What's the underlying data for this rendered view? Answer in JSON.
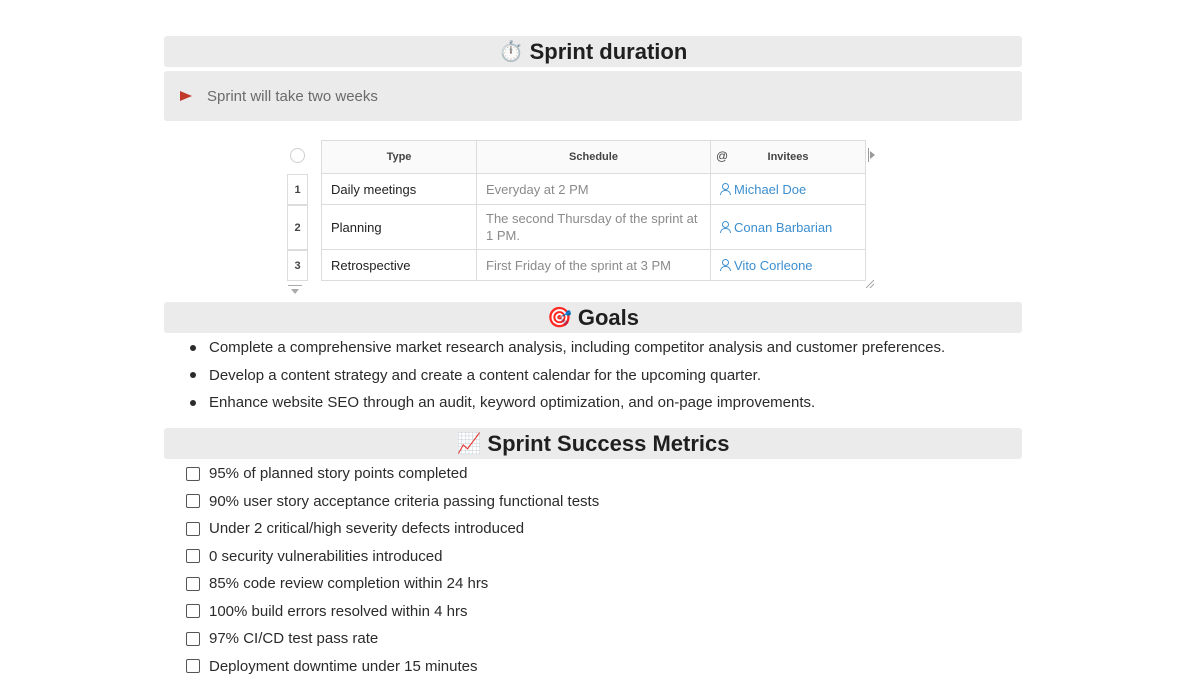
{
  "duration": {
    "emoji": "⏱️",
    "title": "Sprint duration",
    "callout_text": "Sprint will take two weeks"
  },
  "schedule_table": {
    "headers": [
      "Type",
      "Schedule",
      "Invitees"
    ],
    "rows": [
      {
        "num": "1",
        "type": "Daily meetings",
        "schedule": "Everyday at 2 PM",
        "invitee": "Michael Doe"
      },
      {
        "num": "2",
        "type": "Planning",
        "schedule": "The second Thursday of the sprint at 1 PM.",
        "invitee": "Conan Barbarian"
      },
      {
        "num": "3",
        "type": "Retrospective",
        "schedule": "First Friday of the sprint at 3 PM",
        "invitee": "Vito Corleone"
      }
    ],
    "invitee_color": "#3d8fcf"
  },
  "goals": {
    "emoji": "🎯",
    "title": "Goals",
    "items": [
      "Complete a comprehensive market research analysis, including competitor analysis and customer preferences.",
      "Develop a content strategy and create a content calendar for the upcoming quarter.",
      "Enhance website SEO through an audit, keyword optimization, and on-page improvements."
    ]
  },
  "metrics": {
    "emoji": "📈",
    "title": "Sprint Success Metrics",
    "items": [
      "95% of planned story points completed",
      "90% user story acceptance criteria passing functional tests",
      "Under 2 critical/high severity defects introduced",
      "0 security vulnerabilities introduced",
      "85% code review completion within 24 hrs",
      "100% build errors resolved within 4 hrs",
      "97% CI/CD test pass rate",
      "Deployment downtime under 15 minutes"
    ]
  }
}
